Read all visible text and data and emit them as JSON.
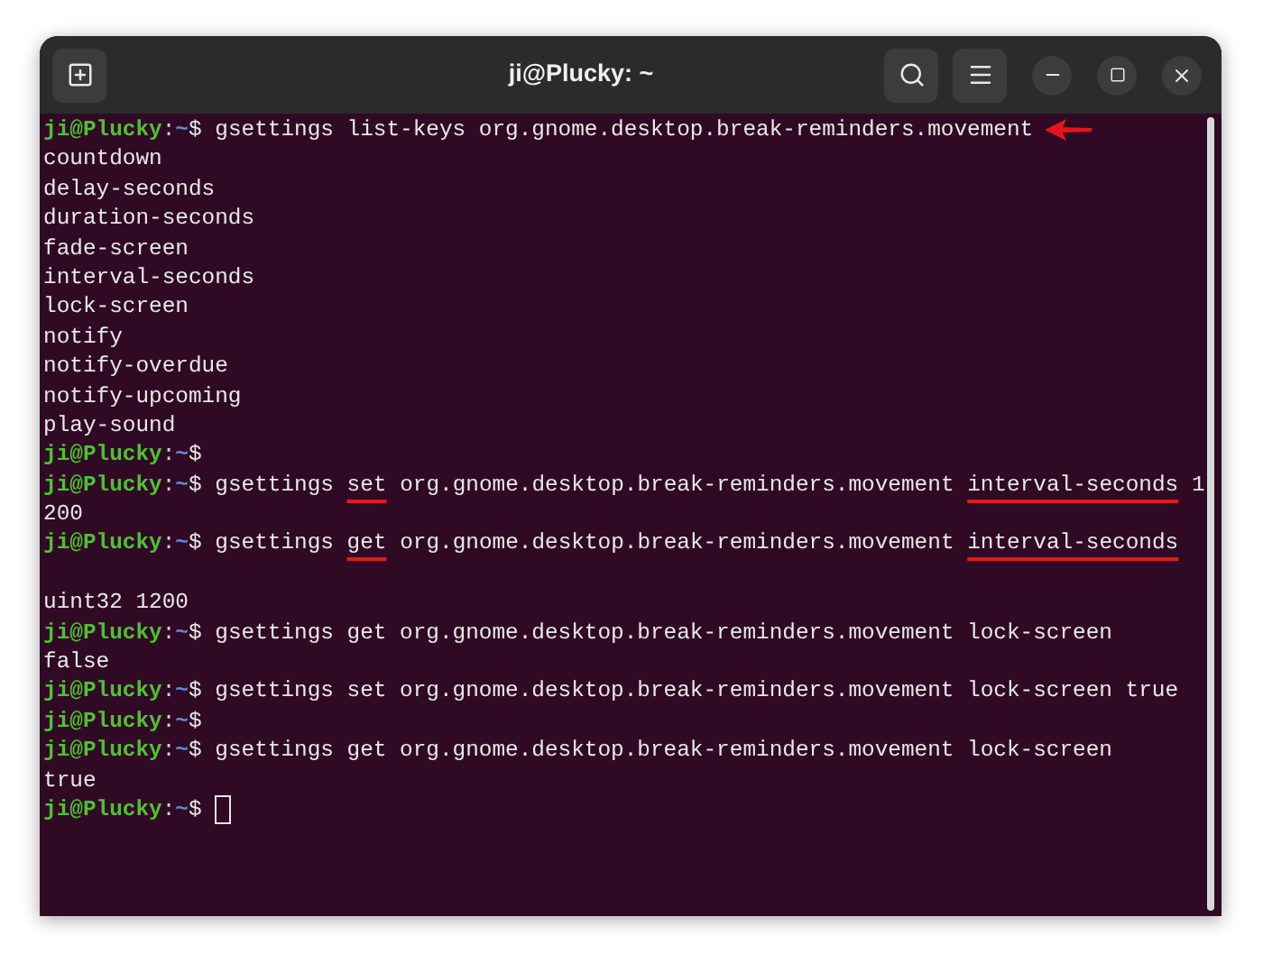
{
  "window": {
    "title": "ji@Plucky: ~"
  },
  "lines": [
    {
      "kind": "prompt",
      "user": "ji@Plucky",
      "separator": ":",
      "path": "~",
      "symbol": "$",
      "arrow": true,
      "segments": [
        {
          "text": "gsettings list-keys org.gnome.desktop.break-reminders.movement",
          "underlined": false
        }
      ]
    },
    {
      "kind": "output",
      "text": "countdown"
    },
    {
      "kind": "output",
      "text": "delay-seconds"
    },
    {
      "kind": "output",
      "text": "duration-seconds"
    },
    {
      "kind": "output",
      "text": "fade-screen"
    },
    {
      "kind": "output",
      "text": "interval-seconds"
    },
    {
      "kind": "output",
      "text": "lock-screen"
    },
    {
      "kind": "output",
      "text": "notify"
    },
    {
      "kind": "output",
      "text": "notify-overdue"
    },
    {
      "kind": "output",
      "text": "notify-upcoming"
    },
    {
      "kind": "output",
      "text": "play-sound"
    },
    {
      "kind": "prompt",
      "user": "ji@Plucky",
      "separator": ":",
      "path": "~",
      "symbol": "$",
      "arrow": false
    },
    {
      "kind": "prompt",
      "user": "ji@Plucky",
      "separator": ":",
      "path": "~",
      "symbol": "$",
      "arrow": false,
      "segments": [
        {
          "text": "gsettings",
          "underlined": false
        },
        {
          "text": "set",
          "underlined": true
        },
        {
          "text": "org.gnome.desktop.break-reminders.movement",
          "underlined": false
        },
        {
          "text": "interval-seconds",
          "underlined": true
        },
        {
          "text": "1",
          "underlined": false
        }
      ]
    },
    {
      "kind": "output",
      "text": "200"
    },
    {
      "kind": "prompt",
      "user": "ji@Plucky",
      "separator": ":",
      "path": "~",
      "symbol": "$",
      "arrow": false,
      "blank_line_after": true,
      "segments": [
        {
          "text": "gsettings",
          "underlined": false
        },
        {
          "text": "get",
          "underlined": true
        },
        {
          "text": "org.gnome.desktop.break-reminders.movement",
          "underlined": false
        },
        {
          "text": "interval-seconds",
          "underlined": true
        }
      ]
    },
    {
      "kind": "output",
      "text": "uint32 1200"
    },
    {
      "kind": "prompt",
      "user": "ji@Plucky",
      "separator": ":",
      "path": "~",
      "symbol": "$",
      "arrow": false,
      "segments": [
        {
          "text": "gsettings get org.gnome.desktop.break-reminders.movement lock-screen",
          "underlined": false
        }
      ]
    },
    {
      "kind": "output",
      "text": "false"
    },
    {
      "kind": "prompt",
      "user": "ji@Plucky",
      "separator": ":",
      "path": "~",
      "symbol": "$",
      "arrow": false,
      "segments": [
        {
          "text": "gsettings set org.gnome.desktop.break-reminders.movement lock-screen true",
          "underlined": false
        }
      ]
    },
    {
      "kind": "prompt",
      "user": "ji@Plucky",
      "separator": ":",
      "path": "~",
      "symbol": "$",
      "arrow": false
    },
    {
      "kind": "prompt",
      "user": "ji@Plucky",
      "separator": ":",
      "path": "~",
      "symbol": "$",
      "arrow": false,
      "segments": [
        {
          "text": "gsettings get org.gnome.desktop.break-reminders.movement lock-screen",
          "underlined": false
        }
      ]
    },
    {
      "kind": "output",
      "text": "true"
    },
    {
      "kind": "prompt",
      "user": "ji@Plucky",
      "separator": ":",
      "path": "~",
      "symbol": "$",
      "arrow": false,
      "cursor": true
    }
  ]
}
